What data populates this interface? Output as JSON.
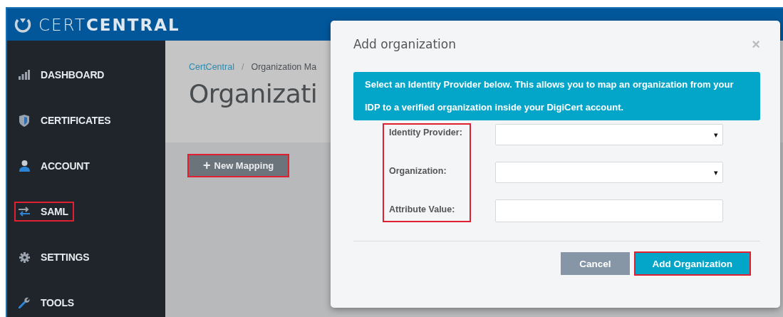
{
  "header": {
    "logo_text": "CERT**CENTRAL**"
  },
  "sidebar": {
    "items": [
      {
        "label": "DASHBOARD",
        "kind": "bars",
        "highlighted": false
      },
      {
        "label": "CERTIFICATES",
        "kind": "shield",
        "highlighted": false
      },
      {
        "label": "ACCOUNT",
        "kind": "person",
        "highlighted": false
      },
      {
        "label": "SAML",
        "kind": "swap",
        "highlighted": true
      },
      {
        "label": "SETTINGS",
        "kind": "gear",
        "highlighted": false
      },
      {
        "label": "TOOLS",
        "kind": "wrench",
        "highlighted": false
      }
    ]
  },
  "content": {
    "breadcrumb": {
      "items": [
        "CertCentral",
        "Organization Ma"
      ],
      "separator": "/"
    },
    "title": "Organizati",
    "new_button": {
      "icon": "+",
      "label": "New Mapping",
      "highlighted": true
    }
  },
  "modal": {
    "title": "Add organization",
    "close": "×",
    "info": "Select an Identity Provider below. This allows you to map an organization from your IDP to a verified organization inside your DigiCert account.",
    "labels_highlighted": true,
    "fields": [
      {
        "label": "Identity Provider:",
        "kind": "select",
        "arrow": "▾"
      },
      {
        "label": "Organization:",
        "kind": "select",
        "arrow": "▾"
      },
      {
        "label": "Attribute Value:",
        "kind": "text"
      }
    ],
    "buttons": [
      {
        "label": "Cancel",
        "kind": "secondary",
        "highlighted": false
      },
      {
        "label": "Add Organization",
        "kind": "primary",
        "highlighted": true
      }
    ]
  }
}
